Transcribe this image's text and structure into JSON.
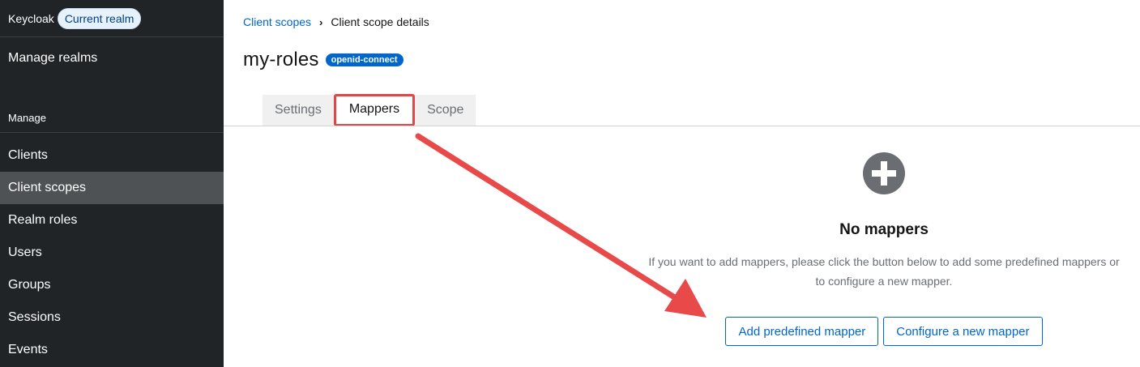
{
  "sidebar": {
    "realm_name": "Keycloak",
    "realm_badge": "Current realm",
    "manage_realms": "Manage realms",
    "section_title": "Manage",
    "items": [
      {
        "label": "Clients"
      },
      {
        "label": "Client scopes",
        "active": true
      },
      {
        "label": "Realm roles"
      },
      {
        "label": "Users"
      },
      {
        "label": "Groups"
      },
      {
        "label": "Sessions"
      },
      {
        "label": "Events"
      }
    ]
  },
  "breadcrumb": {
    "parent": "Client scopes",
    "current": "Client scope details"
  },
  "header": {
    "title": "my-roles",
    "badge": "openid-connect"
  },
  "tabs": [
    {
      "label": "Settings"
    },
    {
      "label": "Mappers",
      "active": true
    },
    {
      "label": "Scope"
    }
  ],
  "empty_state": {
    "icon": "plus-circle-icon",
    "title": "No mappers",
    "body": "If you want to add mappers, please click the button below to add some predefined mappers or to configure a new mapper.",
    "primary_button": "Add predefined mapper",
    "secondary_button": "Configure a new mapper"
  },
  "colors": {
    "sidebar_bg": "#212427",
    "active_item_bg": "#4f5255",
    "link": "#0066cc",
    "annotation": "#e84a4a"
  }
}
